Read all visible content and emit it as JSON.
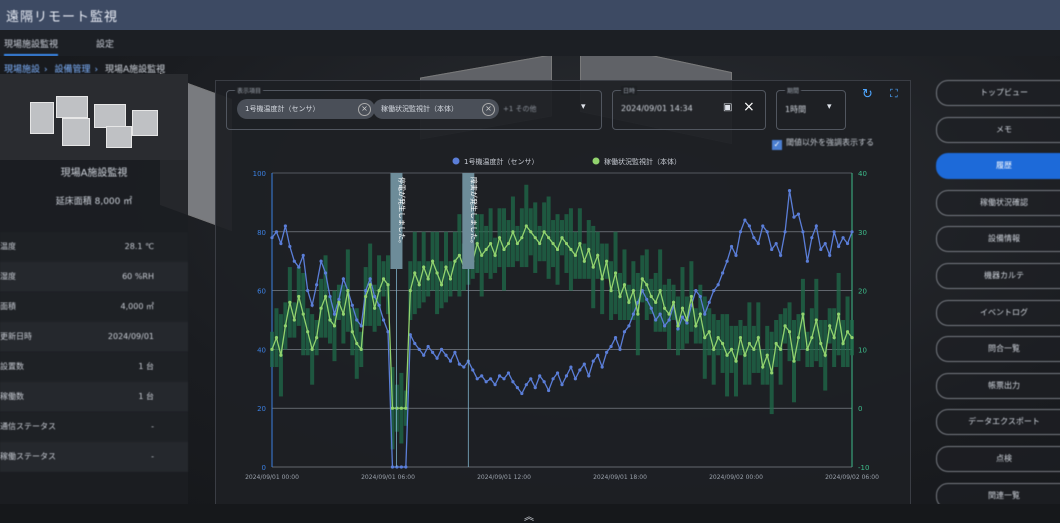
{
  "app": {
    "title": "遠隔リモート監視"
  },
  "tabs": [
    {
      "label": "現場施設監視"
    },
    {
      "label": "設定"
    }
  ],
  "breadcrumb": [
    "現場施設",
    "設備管理",
    "現場A施設監視"
  ],
  "left_panel": {
    "site_name": "現場A施設監視",
    "area": "延床面積 8,000 ㎡",
    "properties": [
      {
        "label": "温度",
        "value": "28.1 ℃"
      },
      {
        "label": "湿度",
        "value": "60 %RH"
      },
      {
        "label": "面積",
        "value": "4,000 ㎡"
      },
      {
        "label": "更新日時",
        "value": "2024/09/01"
      },
      {
        "label": "設置数",
        "value": "1 台"
      },
      {
        "label": "稼働数",
        "value": "1 台"
      },
      {
        "label": "通信ステータス",
        "value": "-"
      },
      {
        "label": "稼働ステータス",
        "value": "-"
      }
    ]
  },
  "filter": {
    "series_label": "表示項目",
    "chips": [
      "1号機温度計（センサ）",
      "稼働状況監視計（本体）"
    ],
    "more": "+1 その他",
    "date_label": "日時",
    "date_value": "2024/09/01 14:34",
    "range_label": "期間",
    "range_value": "1時間",
    "checkbox_label": "閾値以外を強調表示する"
  },
  "right_buttons": [
    {
      "label": "トップビュー",
      "active": false
    },
    {
      "label": "メモ",
      "active": false
    },
    {
      "label": "履歴",
      "active": true
    },
    {
      "label": "稼働状況確認",
      "active": false
    },
    {
      "label": "設備情報",
      "active": false
    },
    {
      "label": "機器カルテ",
      "active": false
    },
    {
      "label": "イベントログ",
      "active": false
    },
    {
      "label": "問合一覧",
      "active": false
    },
    {
      "label": "帳票出力",
      "active": false
    },
    {
      "label": "データエクスポート",
      "active": false
    },
    {
      "label": "点検",
      "active": false
    },
    {
      "label": "関連一覧",
      "active": false
    }
  ],
  "chart_data": {
    "type": "line",
    "legend": [
      "1号機温度計（センサ）",
      "稼働状況監視計（本体）"
    ],
    "colors": {
      "series1": "#5b7ed8",
      "series2": "#92d36e",
      "band": "#1f6b4a",
      "axis_left": "#3b7fe0",
      "axis_right": "#3dbb8a"
    },
    "ylim_left": [
      0,
      100
    ],
    "ylim_right": [
      -10,
      40
    ],
    "yticks_left": [
      0,
      20,
      40,
      60,
      80,
      100
    ],
    "yticks_right": [
      -10,
      0,
      10,
      20,
      30,
      40
    ],
    "xticks": [
      "2024/09/01 00:00",
      "2024/09/01 06:00",
      "2024/09/01 12:00",
      "2024/09/01 18:00",
      "2024/09/02 00:00",
      "2024/09/02 06:00"
    ],
    "annotations": [
      "停電が発生しました。",
      "障害が発生しました。"
    ],
    "series": [
      {
        "name": "1号機温度計（センサ）",
        "axis": "left",
        "values": [
          78,
          80,
          76,
          82,
          75,
          70,
          68,
          72,
          60,
          55,
          62,
          70,
          66,
          58,
          52,
          57,
          64,
          60,
          55,
          50,
          48,
          60,
          64,
          58,
          55,
          50,
          46,
          0,
          0,
          0,
          0,
          45,
          42,
          40,
          38,
          41,
          39,
          37,
          40,
          38,
          36,
          39,
          35,
          34,
          36,
          33,
          30,
          31,
          29,
          30,
          28,
          31,
          30,
          32,
          29,
          27,
          25,
          28,
          30,
          27,
          31,
          29,
          26,
          30,
          32,
          28,
          31,
          34,
          30,
          33,
          35,
          31,
          36,
          38,
          34,
          39,
          41,
          44,
          40,
          46,
          48,
          52,
          56,
          60,
          57,
          54,
          50,
          52,
          48,
          50,
          55,
          47,
          51,
          49,
          55,
          60,
          58,
          52,
          56,
          60,
          62,
          66,
          70,
          75,
          72,
          80,
          84,
          82,
          78,
          76,
          82,
          80,
          74,
          76,
          72,
          80,
          94,
          85,
          86,
          80,
          70,
          78,
          82,
          74,
          76,
          72,
          80,
          75,
          78,
          76,
          80
        ]
      },
      {
        "name": "稼働状況監視計（本体）",
        "axis": "right",
        "values": [
          10,
          12,
          9,
          14,
          18,
          15,
          19,
          16,
          13,
          10,
          12,
          17,
          19,
          15,
          14,
          18,
          16,
          20,
          13,
          11,
          10,
          19,
          21,
          17,
          20,
          22,
          21,
          0,
          0,
          0,
          0,
          20,
          23,
          21,
          24,
          22,
          25,
          23,
          21,
          24,
          22,
          25,
          26,
          24,
          27,
          25,
          28,
          26,
          27,
          28,
          26,
          29,
          27,
          28,
          30,
          28,
          29,
          31,
          30,
          29,
          28,
          30,
          29,
          28,
          27,
          29,
          28,
          27,
          26,
          28,
          25,
          27,
          24,
          26,
          22,
          25,
          20,
          23,
          19,
          21,
          18,
          20,
          16,
          22,
          21,
          19,
          18,
          20,
          17,
          16,
          18,
          14,
          17,
          15,
          19,
          14,
          16,
          12,
          13,
          10,
          12,
          11,
          9,
          10,
          8,
          12,
          9,
          11,
          10,
          12,
          7,
          9,
          6,
          11,
          10,
          14,
          13,
          8,
          12,
          16,
          10,
          12,
          15,
          11,
          9,
          14,
          12,
          16,
          11,
          13,
          12
        ]
      }
    ]
  }
}
